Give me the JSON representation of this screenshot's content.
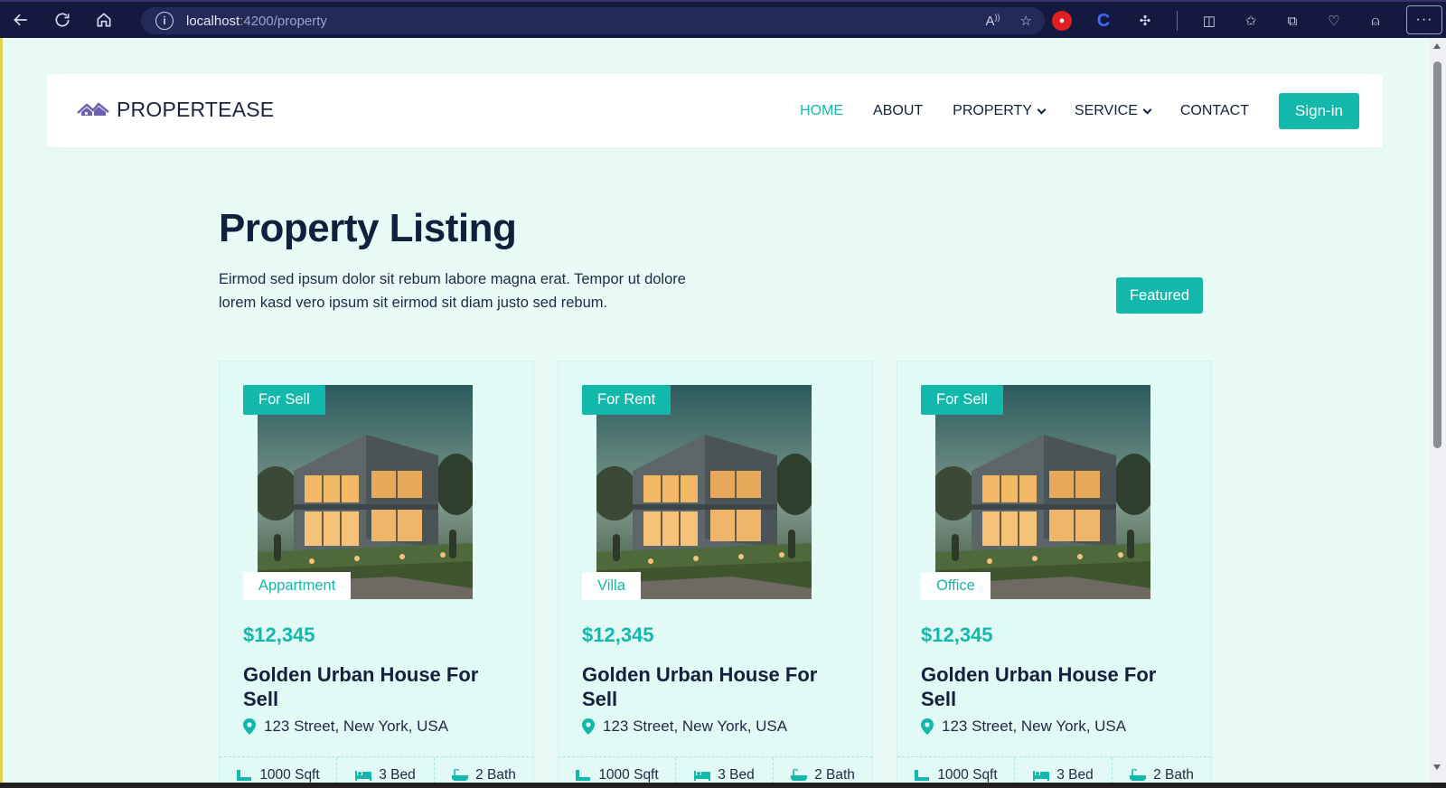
{
  "browser": {
    "url_host": "localhost",
    "url_rest": ":4200/property"
  },
  "navbar": {
    "brand": "PROPERTEASE",
    "menu": [
      {
        "label": "HOME",
        "active": true
      },
      {
        "label": "ABOUT"
      },
      {
        "label": "PROPERTY"
      },
      {
        "label": "SERVICE"
      },
      {
        "label": "CONTACT"
      }
    ],
    "signin_label": "Sign-in"
  },
  "header": {
    "title": "Property Listing",
    "description": "Eirmod sed ipsum dolor sit rebum labore magna erat. Tempor ut dolore lorem kasd vero ipsum sit eirmod sit diam justo sed rebum.",
    "featured_label": "Featured"
  },
  "cards": [
    {
      "status": "For Sell",
      "type": "Appartment",
      "price": "$12,345",
      "title": "Golden Urban House For Sell",
      "address": "123 Street, New York, USA",
      "sqft": "1000 Sqft",
      "bed": "3 Bed",
      "bath": "2 Bath"
    },
    {
      "status": "For Rent",
      "type": "Villa",
      "price": "$12,345",
      "title": "Golden Urban House For Sell",
      "address": "123 Street, New York, USA",
      "sqft": "1000 Sqft",
      "bed": "3 Bed",
      "bath": "2 Bath"
    },
    {
      "status": "For Sell",
      "type": "Office",
      "price": "$12,345",
      "title": "Golden Urban House For Sell",
      "address": "123 Street, New York, USA",
      "sqft": "1000 Sqft",
      "bed": "3 Bed",
      "bath": "2 Bath"
    }
  ],
  "colors": {
    "accent": "#12b8ac",
    "heading": "#10213d",
    "page_bg": "#e8fbf7",
    "chrome_bg": "#141a3f"
  }
}
